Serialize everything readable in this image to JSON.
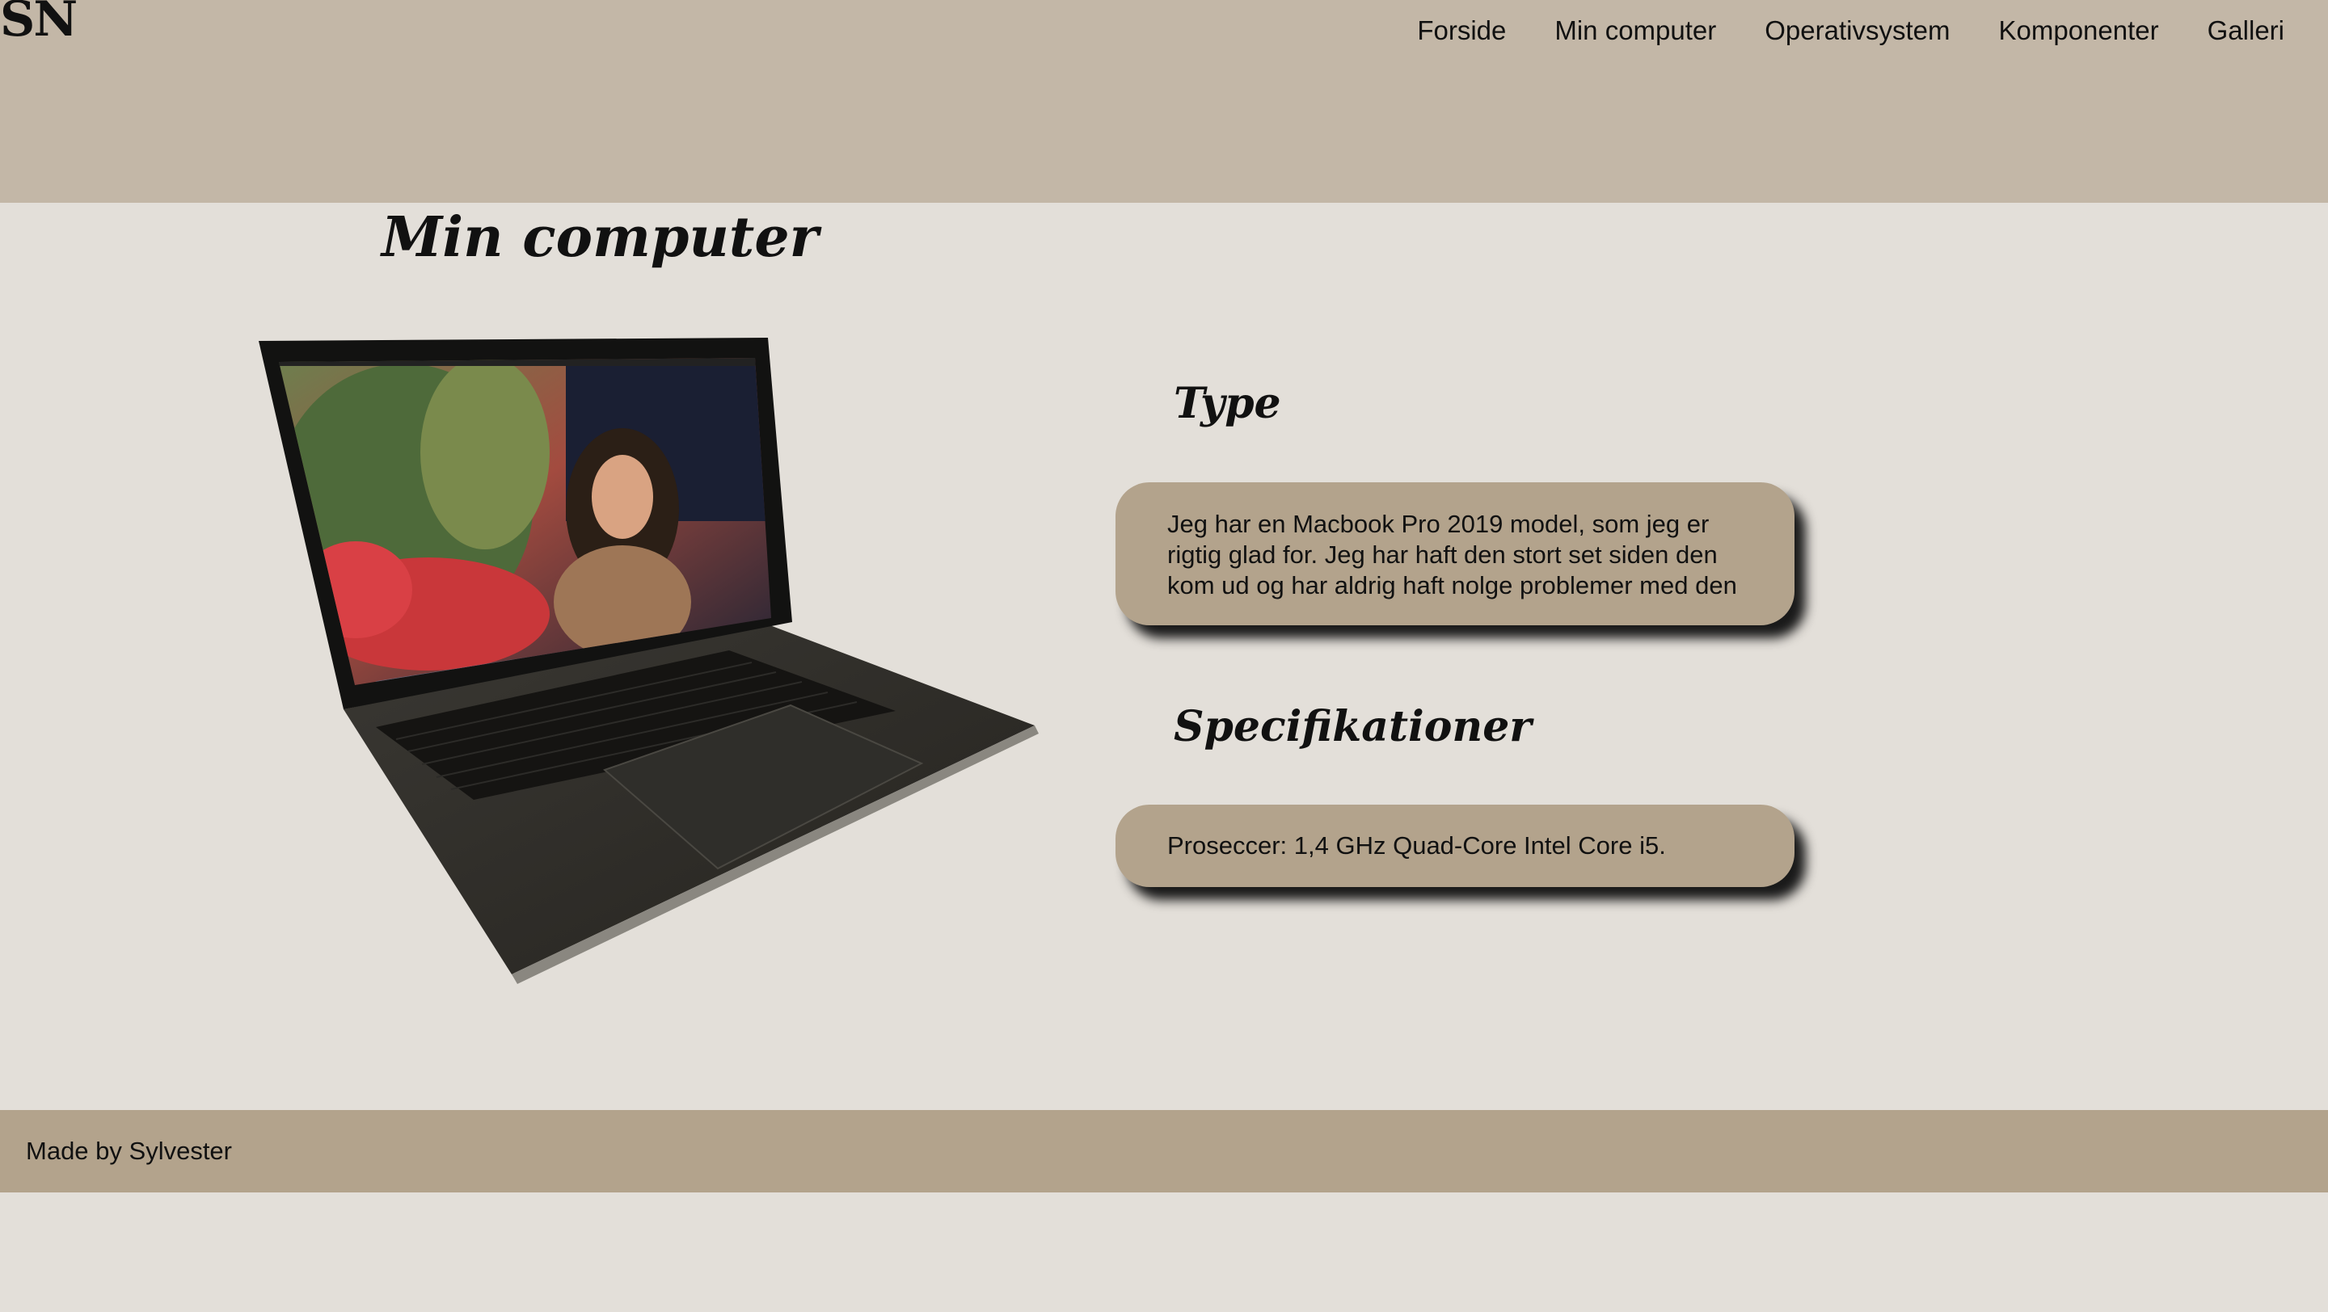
{
  "header": {
    "logo": "SN",
    "nav": [
      "Forside",
      "Min computer",
      "Operativsystem",
      "Komponenter",
      "Galleri"
    ]
  },
  "main": {
    "title": "Min computer",
    "type_heading": "Type",
    "type_text": "Jeg har en Macbook Pro 2019 model, som jeg er rigtig glad for. Jeg har haft den stort set siden den kom ud og har aldrig haft nolge problemer med den",
    "spec_heading": "Specifikationer",
    "spec_text": "Proseccer: 1,4 GHz Quad-Core Intel Core i5."
  },
  "footer": {
    "text": "Made by Sylvester"
  },
  "colors": {
    "header_bg": "#c3b7a7",
    "page_bg": "#e3dfd9",
    "card_bg": "#b3a38c",
    "footer_bg": "#b3a38c"
  }
}
